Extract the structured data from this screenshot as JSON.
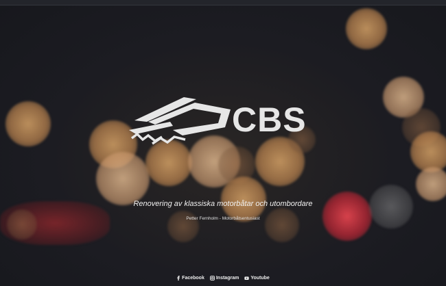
{
  "brand": {
    "name": "CBS",
    "logo": "boat-logo-icon"
  },
  "hero": {
    "tagline": "Renovering av klassiska motorbåtar och utombordare",
    "byline": "Petter Fernholm - Motorbåtsentusiast"
  },
  "social": [
    {
      "label": "Facebook",
      "icon": "facebook-icon"
    },
    {
      "label": "Instagram",
      "icon": "instagram-icon"
    },
    {
      "label": "Youtube",
      "icon": "youtube-icon"
    }
  ],
  "colors": {
    "background": "#1b1c22",
    "text": "#f1f1f1",
    "logo": "#e6e6e6"
  }
}
